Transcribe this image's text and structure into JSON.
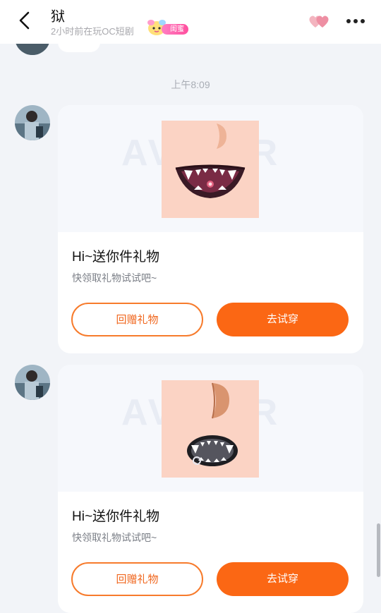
{
  "header": {
    "contact_name": "狱",
    "status": "2小时前在玩OC短剧",
    "relation_tag": "闺蜜"
  },
  "timestamp": "上午8:09",
  "gifts": [
    {
      "title": "Hi~送你件礼物",
      "subtitle": "快领取礼物试试吧~",
      "return_gift_label": "回赠礼物",
      "try_on_label": "去试穿",
      "item": "fanged-smile-mouth"
    },
    {
      "title": "Hi~送你件礼物",
      "subtitle": "快领取礼物试试吧~",
      "return_gift_label": "回赠礼物",
      "try_on_label": "去试穿",
      "item": "fanged-open-mouth"
    }
  ],
  "colors": {
    "accent": "#fb6714",
    "tag_pink": "#ff4f9e"
  }
}
